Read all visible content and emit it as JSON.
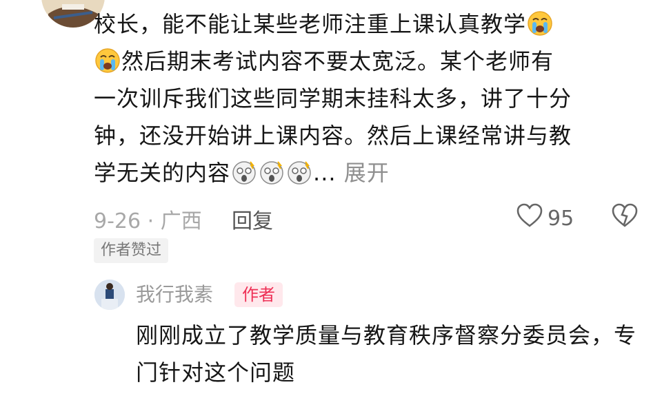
{
  "comment": {
    "line1": "校长，能不能让某些老师注重上课认真教学",
    "line2": "然后期末考试内容不要太宽泛。某个老师有",
    "line3": "一次训斥我们这些同学期末挂科太多，讲了十分",
    "line4": "钟，还没开始讲上课内容。然后上课经常讲与教",
    "line5": "学无关的内容",
    "ellipsis": "...",
    "expand_label": "展开",
    "date_location": "9-26 · 广西",
    "reply_label": "回复",
    "like_count": "95",
    "author_liked_badge": "作者赞过"
  },
  "reply": {
    "username": "我行我素",
    "author_tag": "作者",
    "text": "刚刚成立了教学质量与教育秩序督察分委员会，专门针对这个问题"
  },
  "icons": {
    "crying": "loudly-crying-face-icon",
    "shocked": "face-screaming-icon",
    "like": "heart-outline-icon",
    "dislike": "broken-heart-icon"
  },
  "colors": {
    "text": "#161616",
    "muted": "#a8a8a8",
    "author_tag_bg": "#ffe8ec",
    "author_tag_text": "#ee2f55"
  }
}
